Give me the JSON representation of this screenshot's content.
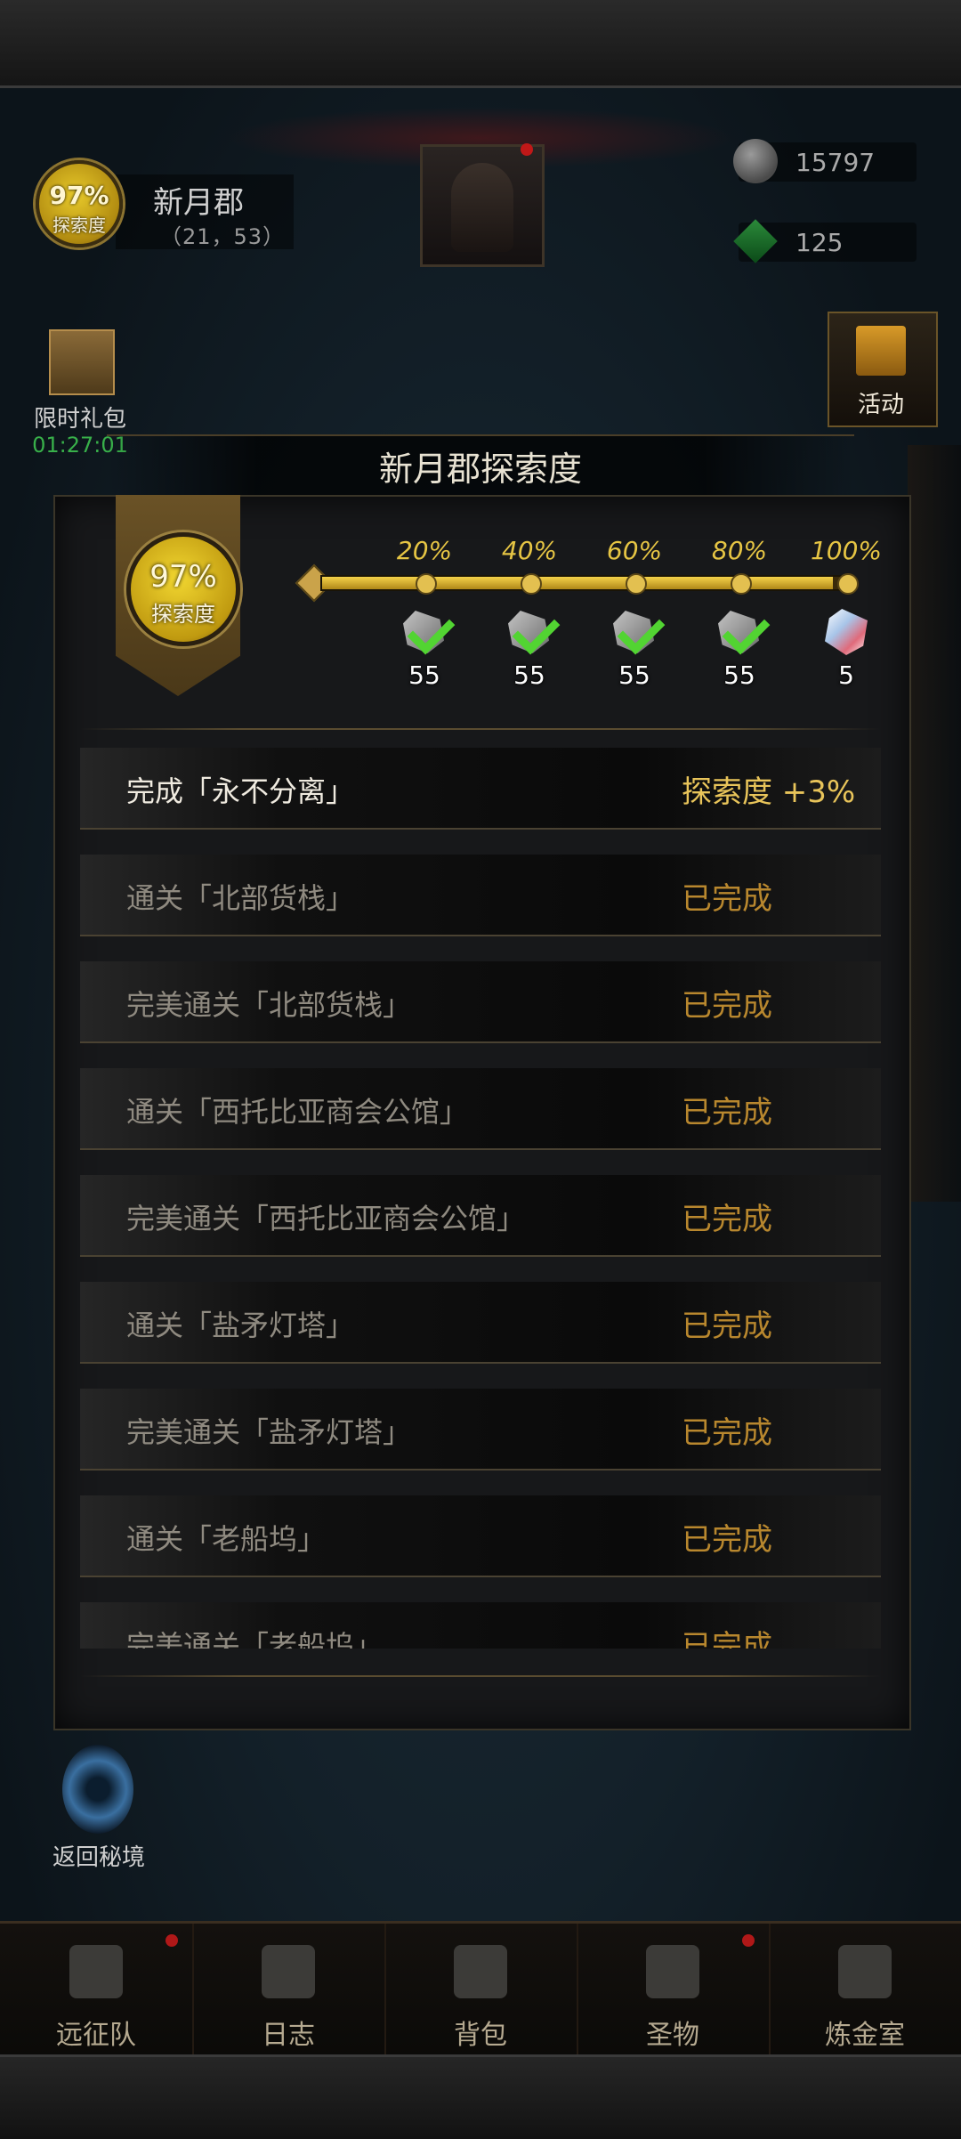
{
  "header": {
    "exploration_percent": "97%",
    "exploration_label": "探索度",
    "region_name": "新月郡",
    "region_coords": "（21，53）",
    "currencies": [
      {
        "icon": "stone-icon",
        "value": "15797"
      },
      {
        "icon": "gem-icon",
        "value": "125"
      }
    ]
  },
  "side": {
    "gift_label": "限时礼包",
    "gift_timer": "01:27:01",
    "activity_label": "活动",
    "portal_label": "返回秘境"
  },
  "panel": {
    "title": "新月郡探索度",
    "badge_percent": "97%",
    "badge_label": "探索度",
    "progress_fraction": 0.97,
    "milestones": [
      {
        "label": "20%",
        "reward": "rock-icon",
        "qty": "55",
        "claimed": true
      },
      {
        "label": "40%",
        "reward": "rock-icon",
        "qty": "55",
        "claimed": true
      },
      {
        "label": "60%",
        "reward": "rock-icon",
        "qty": "55",
        "claimed": true
      },
      {
        "label": "80%",
        "reward": "rock-icon",
        "qty": "55",
        "claimed": true
      },
      {
        "label": "100%",
        "reward": "crystal-icon",
        "qty": "5",
        "claimed": false
      }
    ],
    "tasks": [
      {
        "task": "完成「永不分离」",
        "status": "探索度 +3%"
      },
      {
        "task": "通关「北部货栈」",
        "status": "已完成"
      },
      {
        "task": "完美通关「北部货栈」",
        "status": "已完成"
      },
      {
        "task": "通关「西托比亚商会公馆」",
        "status": "已完成"
      },
      {
        "task": "完美通关「西托比亚商会公馆」",
        "status": "已完成"
      },
      {
        "task": "通关「盐矛灯塔」",
        "status": "已完成"
      },
      {
        "task": "完美通关「盐矛灯塔」",
        "status": "已完成"
      },
      {
        "task": "通关「老船坞」",
        "status": "已完成"
      },
      {
        "task": "完美通关「老船坞」",
        "status": "已完成"
      }
    ]
  },
  "nav": [
    {
      "label": "远征队",
      "icon": "helmet-icon",
      "badge": true
    },
    {
      "label": "日志",
      "icon": "journal-icon",
      "badge": false
    },
    {
      "label": "背包",
      "icon": "backpack-icon",
      "badge": false
    },
    {
      "label": "圣物",
      "icon": "relic-icon",
      "badge": true
    },
    {
      "label": "炼金室",
      "icon": "alchemy-icon",
      "badge": false
    }
  ]
}
